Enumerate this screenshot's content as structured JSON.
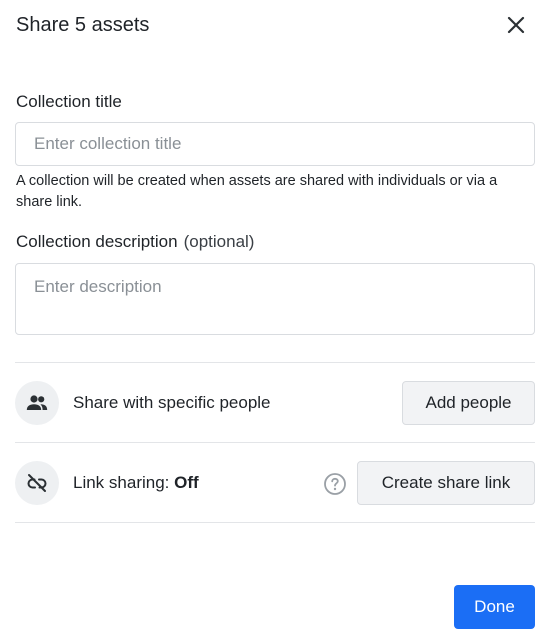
{
  "dialog": {
    "title": "Share 5 assets",
    "close_icon": "close-icon"
  },
  "collection": {
    "title_label": "Collection title",
    "title_placeholder": "Enter collection title",
    "helper_text": "A collection will be created when assets are shared with individuals or via a share link.",
    "description_label": "Collection description",
    "description_optional": "(optional)",
    "description_placeholder": "Enter description"
  },
  "people_row": {
    "icon": "people-icon",
    "label": "Share with specific people",
    "button": "Add people"
  },
  "link_row": {
    "icon": "link-off-icon",
    "label_prefix": "Link sharing:",
    "status": "Off",
    "help_icon": "help-icon",
    "button": "Create share link"
  },
  "footer": {
    "done": "Done"
  },
  "colors": {
    "primary": "#1b6ef5",
    "border": "#d9dce0",
    "icon_bg": "#eef0f2"
  }
}
